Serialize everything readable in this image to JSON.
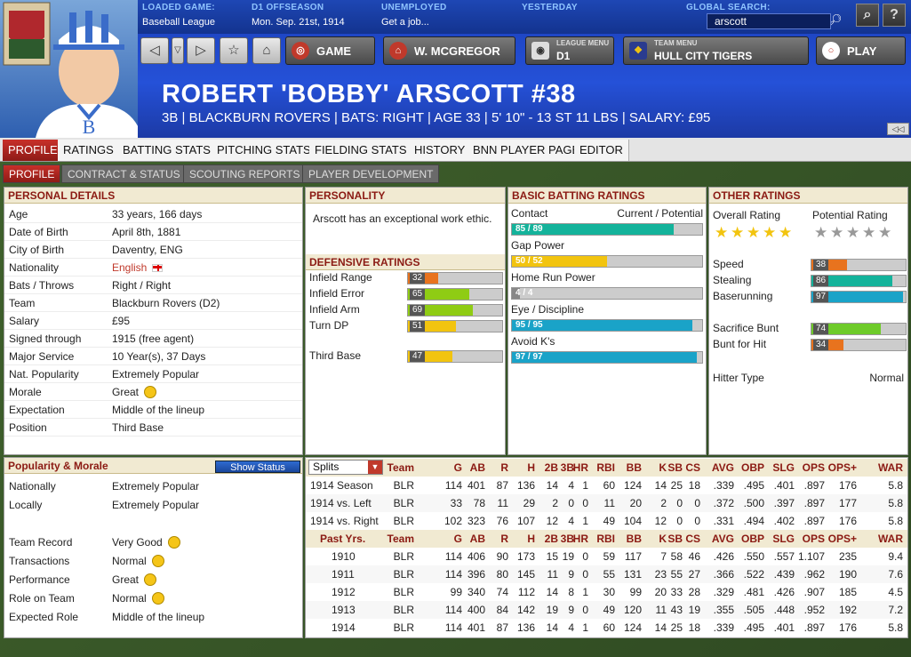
{
  "header": {
    "loaded_label": "LOADED GAME:",
    "loaded_value": "Baseball League",
    "phase_label": "D1 OFFSEASON",
    "date_value": "Mon. Sep. 21st, 1914",
    "status_label": "UNEMPLOYED",
    "status_value": "Get a job...",
    "recent_label": "YESTERDAY",
    "search_label": "GLOBAL SEARCH:",
    "search_value": "arscott",
    "game_btn": "GAME",
    "manager_btn": "W. MCGREGOR",
    "league_menu_label": "LEAGUE MENU",
    "league_menu_value": "D1",
    "team_menu_label": "TEAM MENU",
    "team_menu_value": "HULL CITY TIGERS",
    "play_btn": "PLAY"
  },
  "player": {
    "name": "ROBERT 'BOBBY' ARSCOTT  #38",
    "subline": "3B | BLACKBURN ROVERS | BATS: RIGHT | AGE 33 | 5' 10\" - 13 ST 11 LBS | SALARY: £95"
  },
  "tabs": [
    "PROFILE",
    "RATINGS",
    "BATTING STATS",
    "PITCHING STATS",
    "FIELDING STATS",
    "HISTORY",
    "BNN PLAYER PAGE",
    "EDITOR"
  ],
  "subtabs": [
    "PROFILE",
    "CONTRACT & STATUS",
    "SCOUTING REPORTS",
    "PLAYER DEVELOPMENT"
  ],
  "personal": {
    "title": "PERSONAL DETAILS",
    "rows": [
      [
        "Age",
        "33 years, 166 days"
      ],
      [
        "Date of Birth",
        "April 8th, 1881"
      ],
      [
        "City of Birth",
        "Daventry, ENG"
      ],
      [
        "Nationality",
        "English"
      ],
      [
        "Bats / Throws",
        "Right / Right"
      ],
      [
        "Team",
        "Blackburn Rovers (D2)"
      ],
      [
        "Salary",
        "£95"
      ],
      [
        "Signed through",
        "1915 (free agent)"
      ],
      [
        "Major Service",
        "10 Year(s), 37 Days"
      ],
      [
        "Nat. Popularity",
        "Extremely Popular"
      ],
      [
        "Morale",
        "Great"
      ],
      [
        "Expectation",
        "Middle of the lineup"
      ],
      [
        "Position",
        "Third Base"
      ]
    ]
  },
  "popularity": {
    "title": "Popularity & Morale",
    "button": "Show Status",
    "rows": [
      [
        "Nationally",
        "Extremely Popular"
      ],
      [
        "Locally",
        "Extremely Popular"
      ]
    ],
    "rows2": [
      [
        "Team Record",
        "Very Good"
      ],
      [
        "Transactions",
        "Normal"
      ],
      [
        "Performance",
        "Great"
      ],
      [
        "Role on Team",
        "Normal"
      ],
      [
        "Expected Role",
        "Middle of the lineup"
      ]
    ]
  },
  "personality": {
    "title": "PERSONALITY",
    "text": "Arscott has an exceptional work ethic."
  },
  "defense": {
    "title": "DEFENSIVE RATINGS",
    "items": [
      {
        "label": "Infield Range",
        "value": 32,
        "color": "#e8731e"
      },
      {
        "label": "Infield Error",
        "value": 65,
        "color": "#8fcc14"
      },
      {
        "label": "Infield Arm",
        "value": 69,
        "color": "#8fcc14"
      },
      {
        "label": "Turn DP",
        "value": 51,
        "color": "#f2c40f"
      },
      {
        "label": "Third Base",
        "value": 47,
        "color": "#f2c40f"
      }
    ]
  },
  "batting": {
    "title": "BASIC BATTING RATINGS",
    "cur_pot": "Current / Potential",
    "items": [
      {
        "label": "Contact",
        "text": "85 / 89",
        "value": 85,
        "color": "#14b39b"
      },
      {
        "label": "Gap Power",
        "text": "50 / 52",
        "value": 50,
        "color": "#f2c40f"
      },
      {
        "label": "Home Run Power",
        "text": "4 / 4",
        "value": 4,
        "color": "#888888"
      },
      {
        "label": "Eye / Discipline",
        "text": "95 / 95",
        "value": 95,
        "color": "#1aa3c8"
      },
      {
        "label": "Avoid K's",
        "text": "97 / 97",
        "value": 97,
        "color": "#1aa3c8"
      }
    ]
  },
  "other": {
    "title": "OTHER RATINGS",
    "overall_label": "Overall Rating",
    "potential_label": "Potential Rating",
    "overall_stars": 5,
    "potential_stars": 0,
    "items": [
      {
        "label": "Speed",
        "value": 38,
        "color": "#e8731e"
      },
      {
        "label": "Stealing",
        "value": 86,
        "color": "#14b39b"
      },
      {
        "label": "Baserunning",
        "value": 97,
        "color": "#1aa3c8"
      },
      {
        "label": "Sacrifice Bunt",
        "value": 74,
        "color": "#6ecb2a"
      },
      {
        "label": "Bunt for Hit",
        "value": 34,
        "color": "#e8731e"
      }
    ],
    "hitter_label": "Hitter Type",
    "hitter_value": "Normal"
  },
  "stats": {
    "split_select": "Splits",
    "headers": [
      "Team",
      "G",
      "AB",
      "R",
      "H",
      "2B",
      "3B",
      "HR",
      "RBI",
      "BB",
      "K",
      "SB",
      "CS",
      "AVG",
      "OBP",
      "SLG",
      "OPS",
      "OPS+",
      "WAR"
    ],
    "split_rows": [
      [
        "1914 Season",
        "BLR",
        "114",
        "401",
        "87",
        "136",
        "14",
        "4",
        "1",
        "60",
        "124",
        "14",
        "25",
        "18",
        ".339",
        ".495",
        ".401",
        ".897",
        "176",
        "5.8"
      ],
      [
        "1914 vs. Left",
        "BLR",
        "33",
        "78",
        "11",
        "29",
        "2",
        "0",
        "0",
        "11",
        "20",
        "2",
        "0",
        "0",
        ".372",
        ".500",
        ".397",
        ".897",
        "177",
        "5.8"
      ],
      [
        "1914 vs. Right",
        "BLR",
        "102",
        "323",
        "76",
        "107",
        "12",
        "4",
        "1",
        "49",
        "104",
        "12",
        "0",
        "0",
        ".331",
        ".494",
        ".402",
        ".897",
        "176",
        "5.8"
      ]
    ],
    "past_label": "Past Yrs.",
    "past_rows": [
      [
        "1910",
        "BLR",
        "114",
        "406",
        "90",
        "173",
        "15",
        "19",
        "0",
        "59",
        "117",
        "7",
        "58",
        "46",
        ".426",
        ".550",
        ".557",
        "1.107",
        "235",
        "9.4"
      ],
      [
        "1911",
        "BLR",
        "114",
        "396",
        "80",
        "145",
        "11",
        "9",
        "0",
        "55",
        "131",
        "23",
        "55",
        "27",
        ".366",
        ".522",
        ".439",
        ".962",
        "190",
        "7.6"
      ],
      [
        "1912",
        "BLR",
        "99",
        "340",
        "74",
        "112",
        "14",
        "8",
        "1",
        "30",
        "99",
        "20",
        "33",
        "28",
        ".329",
        ".481",
        ".426",
        ".907",
        "185",
        "4.5"
      ],
      [
        "1913",
        "BLR",
        "114",
        "400",
        "84",
        "142",
        "19",
        "9",
        "0",
        "49",
        "120",
        "11",
        "43",
        "19",
        ".355",
        ".505",
        ".448",
        ".952",
        "192",
        "7.2"
      ],
      [
        "1914",
        "BLR",
        "114",
        "401",
        "87",
        "136",
        "14",
        "4",
        "1",
        "60",
        "124",
        "14",
        "25",
        "18",
        ".339",
        ".495",
        ".401",
        ".897",
        "176",
        "5.8"
      ]
    ]
  }
}
